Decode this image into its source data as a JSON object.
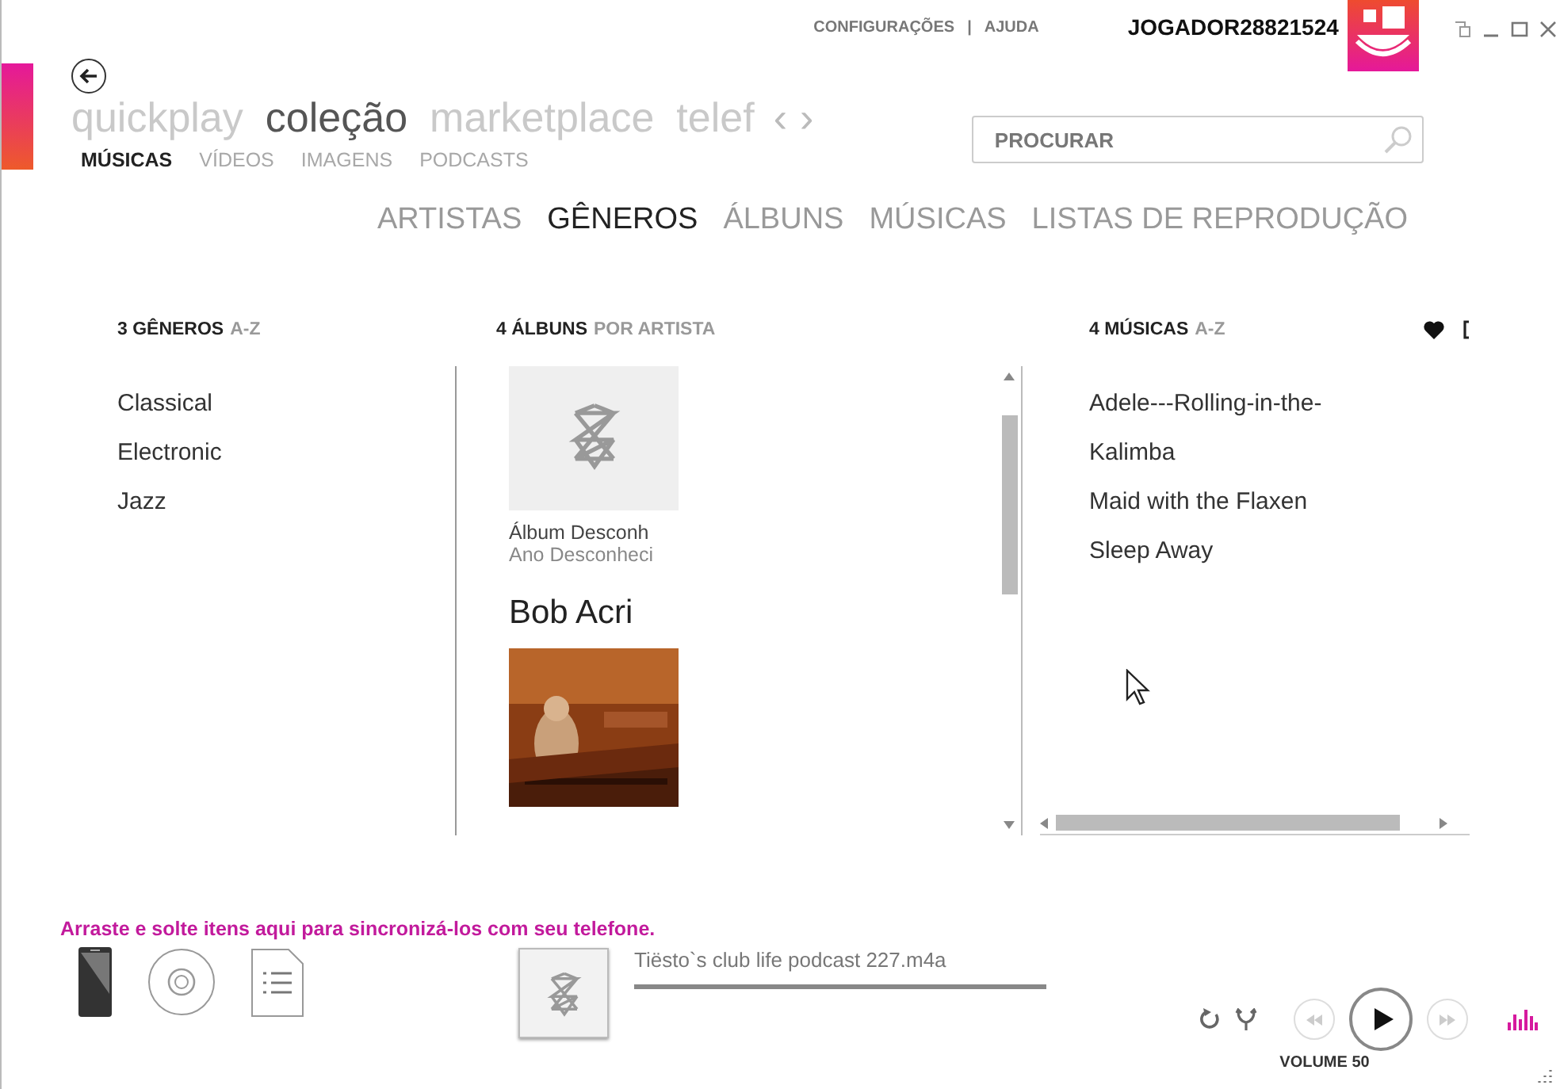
{
  "top_links": [
    {
      "label": "CONFIGURAÇÕES"
    },
    {
      "label": "AJUDA"
    }
  ],
  "top_links_separator": "|",
  "user": {
    "name": "JOGADOR28821524"
  },
  "pivots": [
    {
      "label": "quickplay",
      "selected": false
    },
    {
      "label": "coleção",
      "selected": true
    },
    {
      "label": "marketplace",
      "selected": false
    },
    {
      "label": "telef",
      "selected": false
    }
  ],
  "pivot_arrows": [
    "‹",
    "›"
  ],
  "subnav": [
    {
      "label": "MÚSICAS",
      "selected": true
    },
    {
      "label": "VÍDEOS",
      "selected": false
    },
    {
      "label": "IMAGENS",
      "selected": false
    },
    {
      "label": "PODCASTS",
      "selected": false
    }
  ],
  "search": {
    "placeholder": "PROCURAR"
  },
  "categories": [
    {
      "label": "ARTISTAS",
      "selected": false
    },
    {
      "label": "GÊNEROS",
      "selected": true
    },
    {
      "label": "ÁLBUNS",
      "selected": false
    },
    {
      "label": "MÚSICAS",
      "selected": false
    },
    {
      "label": "LISTAS DE REPRODUÇÃO",
      "selected": false
    }
  ],
  "genres": {
    "count_label": "3 GÊNEROS",
    "sort": "A-Z",
    "items": [
      "Classical",
      "Electronic",
      "Jazz"
    ]
  },
  "albums": {
    "count_label": "4 ÁLBUNS",
    "sort": "POR ARTISTA",
    "items": [
      {
        "kind": "unknown_album",
        "title": "Álbum Desconh",
        "year": "Ano Desconheci"
      },
      {
        "kind": "artist",
        "name": "Bob Acri"
      },
      {
        "kind": "album"
      }
    ]
  },
  "songs": {
    "count_label": "4 MÚSICAS",
    "sort": "A-Z",
    "items": [
      "Adele---Rolling-in-the-",
      "Kalimba",
      "Maid with the Flaxen",
      "Sleep Away"
    ]
  },
  "sync_hint": "Arraste e solte itens aqui para sincronizá-los com seu telefone.",
  "now_playing": {
    "track": "Tiësto`s club life podcast 227.m4a"
  },
  "volume_label": "VOLUME 50"
}
